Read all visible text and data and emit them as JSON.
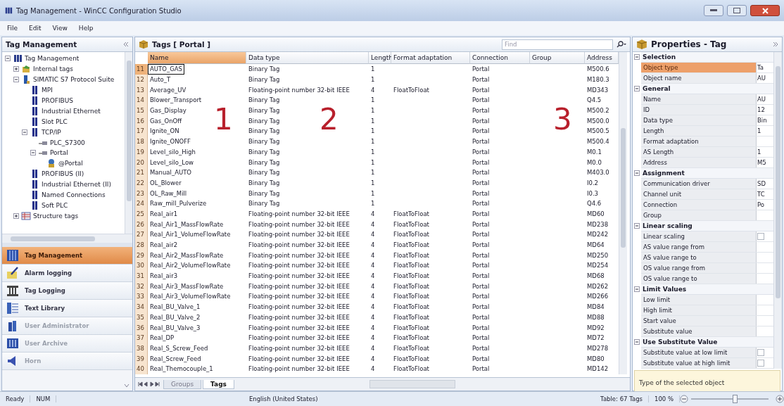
{
  "window": {
    "title": "Tag Management - WinCC Configuration Studio"
  },
  "menu": [
    "File",
    "Edit",
    "View",
    "Help"
  ],
  "navigation": {
    "title": "Tag Management",
    "tree": [
      {
        "label": "Tag Management",
        "kind": "root",
        "expanded": true,
        "children": [
          {
            "label": "Internal tags",
            "kind": "internal",
            "expanded": false
          },
          {
            "label": "SIMATIC S7 Protocol Suite",
            "kind": "driver",
            "expanded": true,
            "children": [
              {
                "label": "MPI",
                "kind": "unit"
              },
              {
                "label": "PROFIBUS",
                "kind": "unit"
              },
              {
                "label": "Industrial Ethernet",
                "kind": "unit"
              },
              {
                "label": "Slot PLC",
                "kind": "unit"
              },
              {
                "label": "TCP/IP",
                "kind": "unit",
                "expanded": true,
                "children": [
                  {
                    "label": "PLC_S7300",
                    "kind": "connection"
                  },
                  {
                    "label": "Portal",
                    "kind": "connection",
                    "expanded": true,
                    "children": [
                      {
                        "label": "@Portal",
                        "kind": "group"
                      }
                    ]
                  }
                ]
              },
              {
                "label": "PROFIBUS (II)",
                "kind": "unit"
              },
              {
                "label": "Industrial Ethernet (II)",
                "kind": "unit"
              },
              {
                "label": "Named Connections",
                "kind": "unit"
              },
              {
                "label": "Soft PLC",
                "kind": "unit"
              }
            ]
          },
          {
            "label": "Structure tags",
            "kind": "structure",
            "expanded": false
          }
        ]
      }
    ],
    "editors": [
      {
        "label": "Tag Management",
        "kind": "tags",
        "selected": true,
        "disabled": false
      },
      {
        "label": "Alarm logging",
        "kind": "alarm",
        "selected": false,
        "disabled": false
      },
      {
        "label": "Tag Logging",
        "kind": "logging",
        "selected": false,
        "disabled": false
      },
      {
        "label": "Text Library",
        "kind": "text",
        "selected": false,
        "disabled": false
      },
      {
        "label": "User Administrator",
        "kind": "users",
        "selected": false,
        "disabled": true
      },
      {
        "label": "User Archive",
        "kind": "archive",
        "selected": false,
        "disabled": true
      },
      {
        "label": "Horn",
        "kind": "horn",
        "selected": false,
        "disabled": true
      }
    ]
  },
  "table": {
    "title": "Tags [ Portal ]",
    "search": {
      "placeholder": "Find"
    },
    "columns": [
      "Name",
      "Data type",
      "Length",
      "Format adaptation",
      "Connection",
      "Group",
      "Address"
    ],
    "rows": [
      {
        "no": "11",
        "name": "AUTO_GAS",
        "data_type": "Binary Tag",
        "length": "1",
        "connection": "Portal",
        "address": "M500.6",
        "selected": true
      },
      {
        "no": "12",
        "name": "Auto_T",
        "data_type": "Binary Tag",
        "length": "1",
        "connection": "Portal",
        "address": "M180.3",
        "selected": false
      },
      {
        "no": "13",
        "name": "Average_UV",
        "data_type": "Floating-point number 32-bit IEEE",
        "length": "4",
        "format": "FloatToFloat",
        "connection": "Portal",
        "address": "MD343",
        "selected": false
      },
      {
        "no": "14",
        "name": "Blower_Transport",
        "data_type": "Binary Tag",
        "length": "1",
        "connection": "Portal",
        "address": "Q4.5",
        "selected": false
      },
      {
        "no": "15",
        "name": "Gas_Display",
        "data_type": "Binary Tag",
        "length": "1",
        "connection": "Portal",
        "address": "M500.2",
        "selected": false
      },
      {
        "no": "16",
        "name": "Gas_OnOff",
        "data_type": "Binary Tag",
        "length": "1",
        "connection": "Portal",
        "address": "M500.0",
        "selected": false
      },
      {
        "no": "17",
        "name": "Ignite_ON",
        "data_type": "Binary Tag",
        "length": "1",
        "connection": "Portal",
        "address": "M500.5",
        "selected": false
      },
      {
        "no": "18",
        "name": "Ignite_ONOFF",
        "data_type": "Binary Tag",
        "length": "1",
        "connection": "Portal",
        "address": "M500.4",
        "selected": false
      },
      {
        "no": "19",
        "name": "Level_silo_High",
        "data_type": "Binary Tag",
        "length": "1",
        "connection": "Portal",
        "address": "M0.1",
        "selected": false
      },
      {
        "no": "20",
        "name": "Level_silo_Low",
        "data_type": "Binary Tag",
        "length": "1",
        "connection": "Portal",
        "address": "M0.0",
        "selected": false
      },
      {
        "no": "21",
        "name": "Manual_AUTO",
        "data_type": "Binary Tag",
        "length": "1",
        "connection": "Portal",
        "address": "M403.0",
        "selected": false
      },
      {
        "no": "22",
        "name": "OL_Blower",
        "data_type": "Binary Tag",
        "length": "1",
        "connection": "Portal",
        "address": "I0.2",
        "selected": false
      },
      {
        "no": "23",
        "name": "OL_Raw_Mill",
        "data_type": "Binary Tag",
        "length": "1",
        "connection": "Portal",
        "address": "I0.3",
        "selected": false
      },
      {
        "no": "24",
        "name": "Raw_mill_Pulverize",
        "data_type": "Binary Tag",
        "length": "1",
        "connection": "Portal",
        "address": "Q4.6",
        "selected": false
      },
      {
        "no": "25",
        "name": "Real_air1",
        "data_type": "Floating-point number 32-bit IEEE",
        "length": "4",
        "format": "FloatToFloat",
        "connection": "Portal",
        "address": "MD60",
        "selected": false
      },
      {
        "no": "26",
        "name": "Real_Air1_MassFlowRate",
        "data_type": "Floating-point number 32-bit IEEE",
        "length": "4",
        "format": "FloatToFloat",
        "connection": "Portal",
        "address": "MD238",
        "selected": false
      },
      {
        "no": "27",
        "name": "Real_Air1_VolumeFlowRate",
        "data_type": "Floating-point number 32-bit IEEE",
        "length": "4",
        "format": "FloatToFloat",
        "connection": "Portal",
        "address": "MD242",
        "selected": false
      },
      {
        "no": "28",
        "name": "Real_air2",
        "data_type": "Floating-point number 32-bit IEEE",
        "length": "4",
        "format": "FloatToFloat",
        "connection": "Portal",
        "address": "MD64",
        "selected": false
      },
      {
        "no": "29",
        "name": "Real_Air2_MassFlowRate",
        "data_type": "Floating-point number 32-bit IEEE",
        "length": "4",
        "format": "FloatToFloat",
        "connection": "Portal",
        "address": "MD250",
        "selected": false
      },
      {
        "no": "30",
        "name": "Real_Air2_VolumeFlowRate",
        "data_type": "Floating-point number 32-bit IEEE",
        "length": "4",
        "format": "FloatToFloat",
        "connection": "Portal",
        "address": "MD254",
        "selected": false
      },
      {
        "no": "31",
        "name": "Real_air3",
        "data_type": "Floating-point number 32-bit IEEE",
        "length": "4",
        "format": "FloatToFloat",
        "connection": "Portal",
        "address": "MD68",
        "selected": false
      },
      {
        "no": "32",
        "name": "Real_Air3_MassFlowRate",
        "data_type": "Floating-point number 32-bit IEEE",
        "length": "4",
        "format": "FloatToFloat",
        "connection": "Portal",
        "address": "MD262",
        "selected": false
      },
      {
        "no": "33",
        "name": "Real_Air3_VolumeFlowRate",
        "data_type": "Floating-point number 32-bit IEEE",
        "length": "4",
        "format": "FloatToFloat",
        "connection": "Portal",
        "address": "MD266",
        "selected": false
      },
      {
        "no": "34",
        "name": "Real_BU_Valve_1",
        "data_type": "Floating-point number 32-bit IEEE",
        "length": "4",
        "format": "FloatToFloat",
        "connection": "Portal",
        "address": "MD84",
        "selected": false
      },
      {
        "no": "35",
        "name": "Real_BU_Valve_2",
        "data_type": "Floating-point number 32-bit IEEE",
        "length": "4",
        "format": "FloatToFloat",
        "connection": "Portal",
        "address": "MD88",
        "selected": false
      },
      {
        "no": "36",
        "name": "Real_BU_Valve_3",
        "data_type": "Floating-point number 32-bit IEEE",
        "length": "4",
        "format": "FloatToFloat",
        "connection": "Portal",
        "address": "MD92",
        "selected": false
      },
      {
        "no": "37",
        "name": "Real_DP",
        "data_type": "Floating-point number 32-bit IEEE",
        "length": "4",
        "format": "FloatToFloat",
        "connection": "Portal",
        "address": "MD72",
        "selected": false
      },
      {
        "no": "38",
        "name": "Real_S_Screw_Feed",
        "data_type": "Floating-point number 32-bit IEEE",
        "length": "4",
        "format": "FloatToFloat",
        "connection": "Portal",
        "address": "MD278",
        "selected": false
      },
      {
        "no": "39",
        "name": "Real_Screw_Feed",
        "data_type": "Floating-point number 32-bit IEEE",
        "length": "4",
        "format": "FloatToFloat",
        "connection": "Portal",
        "address": "MD80",
        "selected": false
      },
      {
        "no": "40",
        "name": "Real_Themocouple_1",
        "data_type": "Floating-point number 32-bit IEEE",
        "length": "4",
        "format": "FloatToFloat",
        "connection": "Portal",
        "address": "MD142",
        "selected": false
      }
    ],
    "sheet_tabs": [
      {
        "label": "Groups",
        "selected": false
      },
      {
        "label": "Tags",
        "selected": true
      }
    ],
    "annotations": [
      "1",
      "2",
      "3"
    ]
  },
  "properties": {
    "title": "Properties - Tag",
    "groups": [
      {
        "label": "Selection",
        "expanded": true,
        "items": [
          {
            "label": "Object type",
            "value": "Ta",
            "selected": true
          },
          {
            "label": "Object name",
            "value": "AU",
            "selected": false
          }
        ]
      },
      {
        "label": "General",
        "expanded": true,
        "items": [
          {
            "label": "Name",
            "value": "AU",
            "selected": false
          },
          {
            "label": "ID",
            "value": "12",
            "selected": false
          },
          {
            "label": "Data type",
            "value": "Bin",
            "selected": false
          },
          {
            "label": "Length",
            "value": "1",
            "selected": false
          },
          {
            "label": "Format adaptation",
            "selected": false
          },
          {
            "label": "AS Length",
            "value": "1",
            "selected": false
          },
          {
            "label": "Address",
            "value": "M5",
            "selected": false
          }
        ]
      },
      {
        "label": "Assignment",
        "expanded": true,
        "items": [
          {
            "label": "Communication driver",
            "value": "SD",
            "selected": false
          },
          {
            "label": "Channel unit",
            "value": "TC",
            "selected": false
          },
          {
            "label": "Connection",
            "value": "Po",
            "selected": false
          },
          {
            "label": "Group",
            "selected": false
          }
        ]
      },
      {
        "label": "Linear scaling",
        "expanded": true,
        "items": [
          {
            "label": "Linear scaling",
            "kind": "checkbox",
            "checked": false,
            "selected": false
          },
          {
            "label": "AS value range from",
            "selected": false
          },
          {
            "label": "AS value range to",
            "selected": false
          },
          {
            "label": "OS value range from",
            "selected": false
          },
          {
            "label": "OS value range to",
            "selected": false
          }
        ]
      },
      {
        "label": "Limit Values",
        "expanded": true,
        "items": [
          {
            "label": "Low limit",
            "selected": false
          },
          {
            "label": "High limit",
            "selected": false
          },
          {
            "label": "Start value",
            "selected": false
          },
          {
            "label": "Substitute value",
            "selected": false
          }
        ]
      },
      {
        "label": "Use Substitute Value",
        "expanded": true,
        "items": [
          {
            "label": "Substitute value at low limit",
            "kind": "checkbox",
            "checked": false,
            "selected": false
          },
          {
            "label": "Substitute value at high limit",
            "kind": "checkbox",
            "checked": false,
            "selected": false
          }
        ]
      }
    ],
    "description": "Type of the selected object"
  },
  "status_bar": {
    "state": "Ready",
    "num": "NUM",
    "language": "English (United States)",
    "count": "Table: 67 Tags",
    "zoom": "100 %",
    "zoom_slider": {
      "level": 0.56
    }
  }
}
